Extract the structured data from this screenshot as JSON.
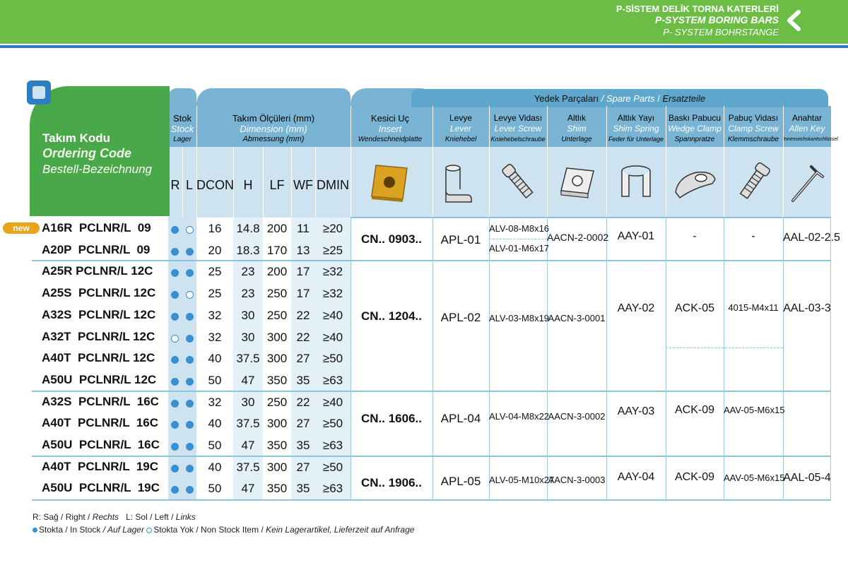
{
  "banner": {
    "title_tr": "P-SİSTEM DELİK TORNA KATERLERİ",
    "title_en": "P-SYSTEM BORING BARS",
    "title_de": "P- SYSTEM BOHRSTANGE"
  },
  "header": {
    "ordering_tr": "Takım Kodu",
    "ordering_en": "Ordering Code",
    "ordering_de": "Bestell-Bezeichnung",
    "stock_tr": "Stok",
    "stock_en": "Stock",
    "stock_de": "Lager",
    "dim_tr": "Takım Ölçüleri (mm)",
    "dim_en": "Dimension (mm)",
    "dim_de": "Abmessung (mm)",
    "insert_tr": "Kesici Uç",
    "insert_en": "Insert",
    "insert_de": "Wendeschneidplatte",
    "spare_tr": "Yedek Parçaları",
    "spare_sep1": " / ",
    "spare_en": "Spare Parts",
    "spare_sep2": " / ",
    "spare_de": "Ersatzteile",
    "cols": [
      "R",
      "L",
      "DCON",
      "H",
      "LF",
      "WF",
      "DMIN"
    ],
    "parts": [
      {
        "tr": "Levye",
        "en": "Lever",
        "de": "Kniehebel"
      },
      {
        "tr": "Levye Vidası",
        "en": "Lever Screw",
        "de": "Kniehebelschraube"
      },
      {
        "tr": "Altlık",
        "en": "Shim",
        "de": "Unterlage"
      },
      {
        "tr": "Altlık Yayı",
        "en": "Shim Spring",
        "de": "Feder für Unterlage"
      },
      {
        "tr": "Baskı Pabucu",
        "en": "Wedge Clamp",
        "de": "Spannpratze"
      },
      {
        "tr": "Pabuç Vidası",
        "en": "Clamp Screw",
        "de": "Klemmschraube"
      },
      {
        "tr": "Anahtar",
        "en": "Allen Key",
        "de": "Innensechskantschlüssel"
      }
    ]
  },
  "new_badge": "new",
  "rows": [
    {
      "code": "A16R  PCLNR/L  09",
      "r": "full",
      "l": "empty",
      "dcon": "16",
      "h": "14.8",
      "lf": "200",
      "wf": "11",
      "dmin": "≥20"
    },
    {
      "code": "A20P  PCLNR/L  09",
      "r": "full",
      "l": "full",
      "dcon": "20",
      "h": "18.3",
      "lf": "170",
      "wf": "13",
      "dmin": "≥25"
    },
    {
      "code": "A25R PCLNR/L 12C",
      "r": "full",
      "l": "full",
      "dcon": "25",
      "h": "23",
      "lf": "200",
      "wf": "17",
      "dmin": "≥32"
    },
    {
      "code": "A25S  PCLNR/L 12C",
      "r": "full",
      "l": "empty",
      "dcon": "25",
      "h": "23",
      "lf": "250",
      "wf": "17",
      "dmin": "≥32"
    },
    {
      "code": "A32S  PCLNR/L 12C",
      "r": "full",
      "l": "full",
      "dcon": "32",
      "h": "30",
      "lf": "250",
      "wf": "22",
      "dmin": "≥40"
    },
    {
      "code": "A32T  PCLNR/L 12C",
      "r": "empty",
      "l": "full",
      "dcon": "32",
      "h": "30",
      "lf": "300",
      "wf": "22",
      "dmin": "≥40"
    },
    {
      "code": "A40T  PCLNR/L 12C",
      "r": "full",
      "l": "full",
      "dcon": "40",
      "h": "37.5",
      "lf": "300",
      "wf": "27",
      "dmin": "≥50"
    },
    {
      "code": "A50U  PCLNR/L 12C",
      "r": "full",
      "l": "full",
      "dcon": "50",
      "h": "47",
      "lf": "350",
      "wf": "35",
      "dmin": "≥63"
    },
    {
      "code": "A32S  PCLNR/L  16C",
      "r": "full",
      "l": "full",
      "dcon": "32",
      "h": "30",
      "lf": "250",
      "wf": "22",
      "dmin": "≥40"
    },
    {
      "code": "A40T  PCLNR/L  16C",
      "r": "full",
      "l": "full",
      "dcon": "40",
      "h": "37.5",
      "lf": "300",
      "wf": "27",
      "dmin": "≥50"
    },
    {
      "code": "A50U  PCLNR/L  16C",
      "r": "full",
      "l": "full",
      "dcon": "50",
      "h": "47",
      "lf": "350",
      "wf": "35",
      "dmin": "≥63"
    },
    {
      "code": "A40T  PCLNR/L  19C",
      "r": "full",
      "l": "full",
      "dcon": "40",
      "h": "37.5",
      "lf": "300",
      "wf": "27",
      "dmin": "≥50"
    },
    {
      "code": "A50U  PCLNR/L  19C",
      "r": "full",
      "l": "full",
      "dcon": "50",
      "h": "47",
      "lf": "350",
      "wf": "35",
      "dmin": "≥63"
    }
  ],
  "groups": {
    "g09": {
      "insert": "CN.. 0903..",
      "lever": "APL-01",
      "lever_screw_a": "ALV-08-M8x16",
      "lever_screw_b": "ALV-01-M6x17",
      "shim": "AACN-2-0002",
      "shim_spring": "AAY-01",
      "wedge": "-",
      "clamp_screw": "-",
      "key": "AAL-02-2.5"
    },
    "g12": {
      "insert": "CN.. 1204..",
      "lever": "APL-02",
      "lever_screw": "ALV-03-M8x19",
      "shim": "AACN-3-0001",
      "shim_spring": "AAY-02",
      "wedge": "ACK-05",
      "clamp_screw": "4015-M4x11",
      "key": "AAL-03-3"
    },
    "g16": {
      "insert": "CN.. 1606..",
      "lever": "APL-04",
      "lever_screw": "ALV-04-M8x22",
      "shim": "AACN-3-0002",
      "shim_spring": "AAY-03",
      "wedge": "ACK-09",
      "clamp_screw": "AAV-05-M6x15"
    },
    "g19": {
      "insert": "CN.. 1906..",
      "lever": "APL-05",
      "lever_screw": "ALV-05-M10x27",
      "shim": "AACN-3-0003",
      "shim_spring": "AAY-04",
      "wedge": "ACK-09",
      "clamp_screw": "AAV-05-M6x15",
      "key": "AAL-05-4"
    }
  },
  "footer": {
    "line1_a": "R: Sağ / Right / ",
    "line1_b": "Rechts",
    "line1_c": "   L: Sol / Left / ",
    "line1_d": "Links",
    "line2_a": "Stokta / In Stock ",
    "line2_b": "/ Auf Lager",
    "line2_c": "Stokta Yok / Non Stock Item / ",
    "line2_d": "Kein Lagerartikel, Lieferzeit auf Anfrage"
  },
  "colors": {
    "banner": "#6cbd45",
    "header": "#79b4d4",
    "light": "#cde4f0",
    "green": "#49a847",
    "dot": "#3a90cf"
  }
}
